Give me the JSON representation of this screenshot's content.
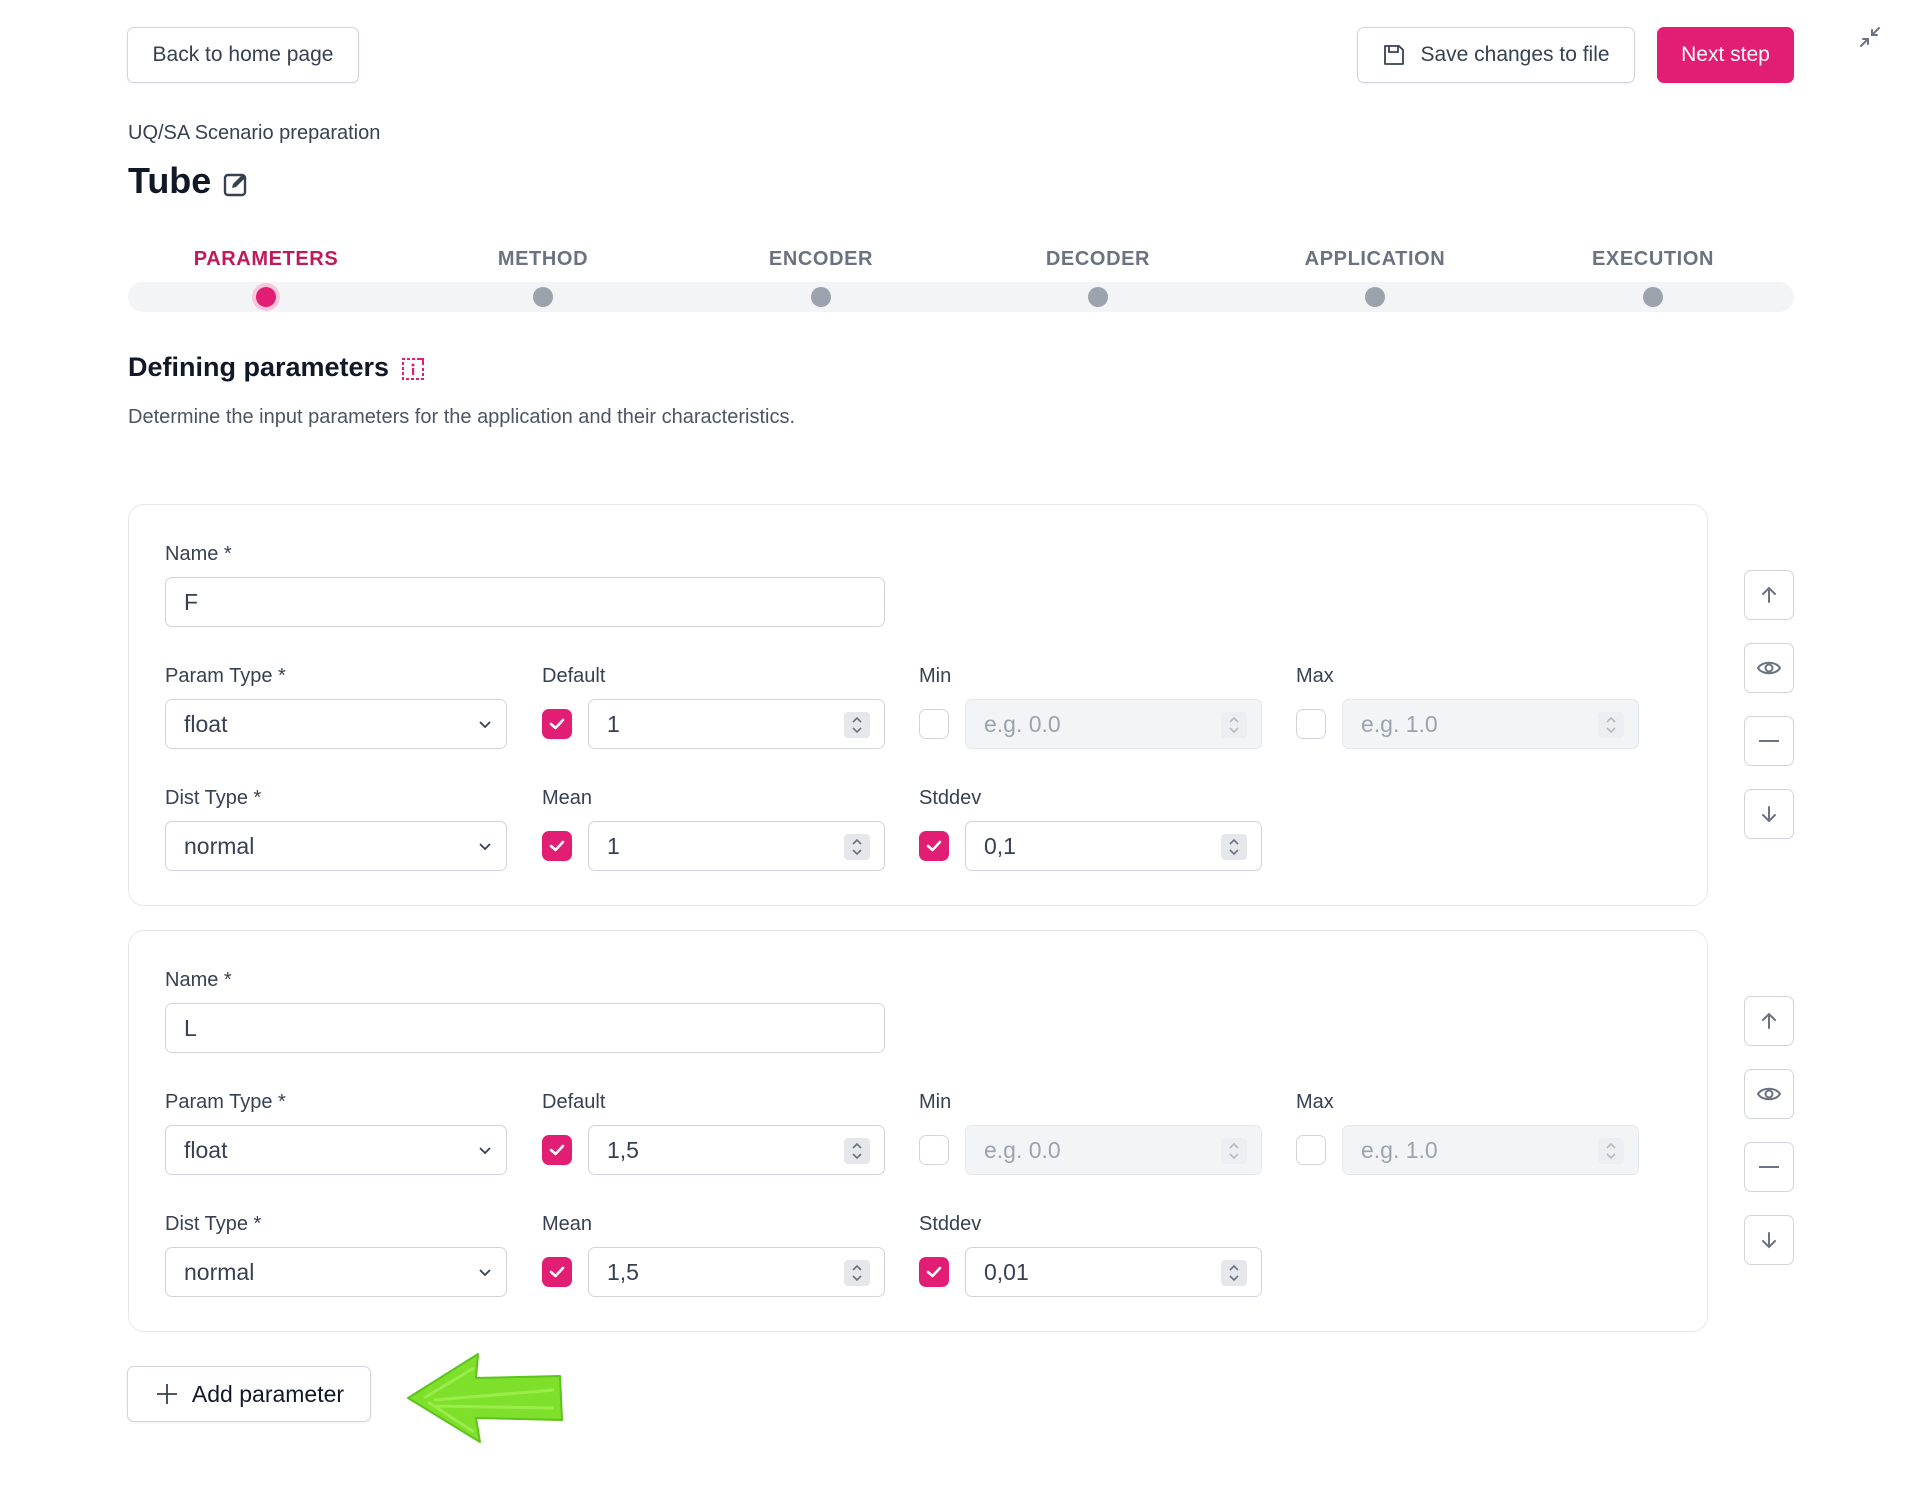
{
  "toolbar": {
    "back_label": "Back to home page",
    "save_label": "Save changes to file",
    "next_label": "Next step"
  },
  "header": {
    "subtitle": "UQ/SA Scenario preparation",
    "title": "Tube"
  },
  "steps": [
    {
      "label": "PARAMETERS",
      "active": true
    },
    {
      "label": "METHOD",
      "active": false
    },
    {
      "label": "ENCODER",
      "active": false
    },
    {
      "label": "DECODER",
      "active": false
    },
    {
      "label": "APPLICATION",
      "active": false
    },
    {
      "label": "EXECUTION",
      "active": false
    }
  ],
  "section": {
    "title": "Defining parameters",
    "description": "Determine the input parameters for the application and their characteristics."
  },
  "labels": {
    "name": "Name *",
    "param_type": "Param Type *",
    "default": "Default",
    "min": "Min",
    "max": "Max",
    "dist_type": "Dist Type *",
    "mean": "Mean",
    "stddev": "Stddev"
  },
  "parameters": [
    {
      "name": "F",
      "param_type": "float",
      "default": "1",
      "default_checked": true,
      "min_placeholder": "e.g. 0.0",
      "min_checked": false,
      "max_placeholder": "e.g. 1.0",
      "max_checked": false,
      "dist_type": "normal",
      "mean": "1",
      "mean_checked": true,
      "stddev": "0,1",
      "stddev_checked": true
    },
    {
      "name": "L",
      "param_type": "float",
      "default": "1,5",
      "default_checked": true,
      "min_placeholder": "e.g. 0.0",
      "min_checked": false,
      "max_placeholder": "e.g. 1.0",
      "max_checked": false,
      "dist_type": "normal",
      "mean": "1,5",
      "mean_checked": true,
      "stddev": "0,01",
      "stddev_checked": true
    }
  ],
  "add_parameter_label": "Add parameter",
  "colors": {
    "accent": "#e11d74",
    "annotation_arrow": "#7ee02a"
  },
  "icons": {
    "save": "floppy-disk-icon",
    "edit": "edit-square-icon",
    "info": "info-box-icon",
    "collapse": "collapse-arrows-icon",
    "up": "arrow-up-icon",
    "view": "eye-icon",
    "remove": "minus-icon",
    "down": "arrow-down-icon",
    "add": "plus-icon"
  }
}
